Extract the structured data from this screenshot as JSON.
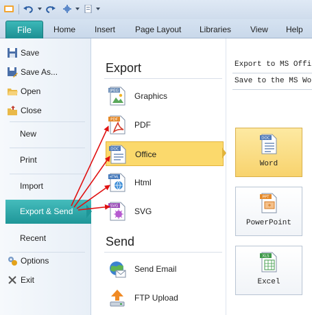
{
  "ribbon": {
    "file_tab": "File",
    "tabs": [
      "Home",
      "Insert",
      "Page Layout",
      "Libraries",
      "View",
      "Help"
    ]
  },
  "backstage": {
    "commands": [
      "Save",
      "Save As...",
      "Open",
      "Close"
    ],
    "nav": [
      "New",
      "Print",
      "Import",
      "Export & Send",
      "Recent"
    ],
    "bottom_commands": [
      "Options",
      "Exit"
    ]
  },
  "middle": {
    "export_heading": "Export",
    "export_items": [
      "Graphics",
      "PDF",
      "Office",
      "Html",
      "SVG"
    ],
    "send_heading": "Send",
    "send_items": [
      "Send Email",
      "FTP Upload"
    ]
  },
  "right": {
    "title": "Export to MS Office",
    "description": "Save to the MS Word",
    "formats": [
      "Word",
      "PowerPoint",
      "Excel"
    ],
    "format_tags": [
      "DOC",
      "PPT",
      "XLS"
    ]
  },
  "icon_tags": {
    "graphics": "JPEG",
    "pdf": "PDF",
    "office": "DOC",
    "html": "HTML",
    "svg": "SVG"
  },
  "colors": {
    "accent_teal": "#1e9698",
    "highlight_yellow": "#fbd96c",
    "arrow_red": "#e01010"
  }
}
